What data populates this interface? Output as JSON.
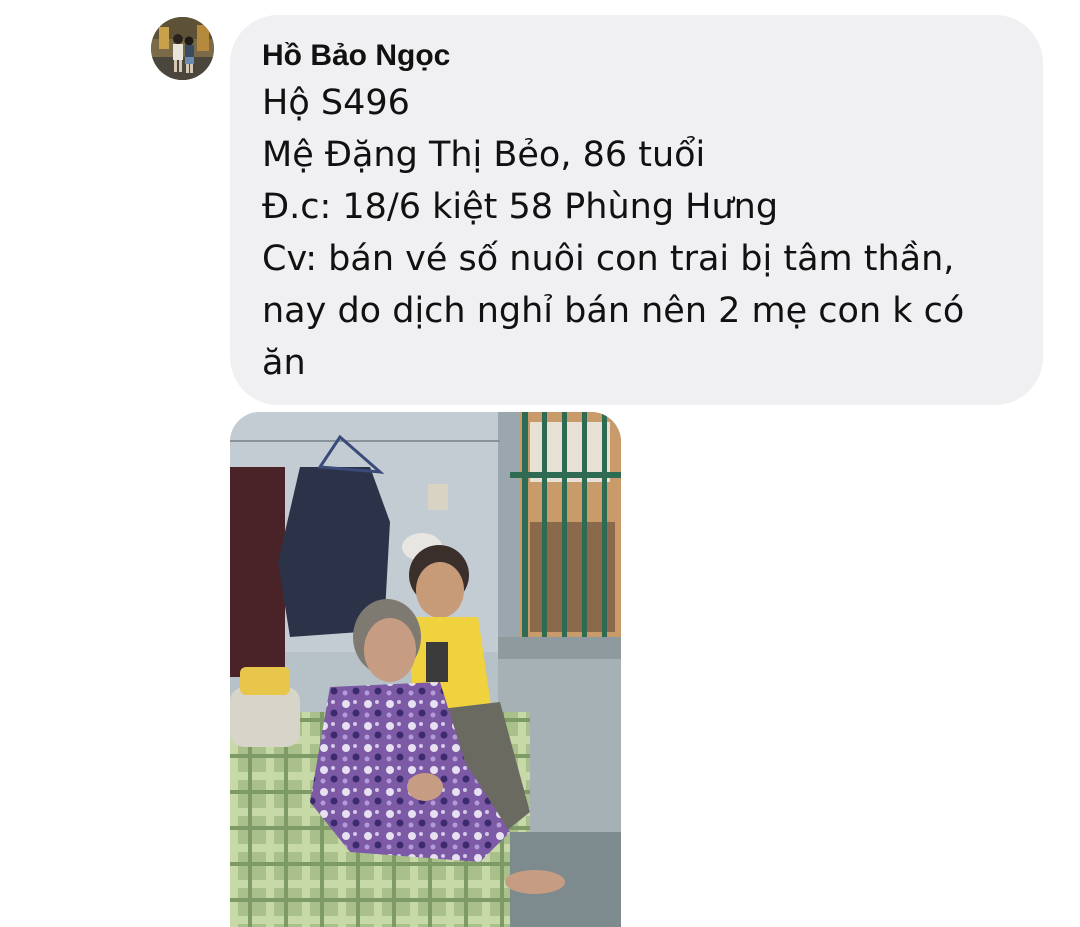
{
  "message": {
    "sender_name": "Hồ Bảo Ngọc",
    "lines": [
      "Hộ S496",
      "Mệ Đặng Thị Bẻo, 86 tuổi",
      "Đ.c: 18/6 kiệt 58 Phùng Hưng",
      "Cv: bán vé số nuôi con trai bị tâm thần,",
      "nay do dịch nghỉ bán nên 2 mẹ con k có",
      "ăn"
    ]
  },
  "colors": {
    "bubble_background": "#f0f0f3",
    "text": "#111111",
    "page_background": "#ffffff"
  }
}
